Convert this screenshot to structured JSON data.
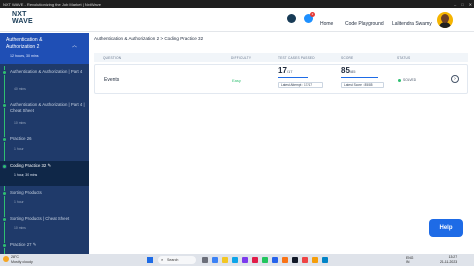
{
  "window": {
    "title": "NXT WAVE - Revolutionizing the Job Market | NxtWave",
    "controls": [
      "–",
      "□",
      "✕"
    ]
  },
  "header": {
    "logo_top": "NXT",
    "logo_bottom": "WAVE",
    "notification_count": "2",
    "home": "Home",
    "code_playground": "Code Playground",
    "user_name": "Lalitendra Swamy"
  },
  "sidebar": {
    "title": "Authentication & Authorization 2",
    "duration": "12 hours, 30 mins",
    "items": [
      {
        "label": "Authentication & Authorization | Part 4",
        "duration": "40 mins"
      },
      {
        "label": "Authentication & Authorization | Part 4 | Cheat Sheet",
        "duration": "10 mins"
      },
      {
        "label": "Practice 26",
        "duration": "1 hour"
      },
      {
        "label": "Coding Practice 32",
        "duration": "1 hour, 30 mins"
      },
      {
        "label": "Sorting Products",
        "duration": "1 hour"
      },
      {
        "label": "Sorting Products | Cheat Sheet",
        "duration": "10 mins"
      },
      {
        "label": "Practice 27",
        "duration": ""
      }
    ]
  },
  "main": {
    "breadcrumb": "Authentication & Authorization 2 > Coding Practice 32",
    "columns": [
      "QUESTION",
      "DIFFICULTY",
      "TEST CASES PASSED",
      "SCORE",
      "STATUS"
    ],
    "row": {
      "question": "Events",
      "difficulty": "Easy",
      "tests_passed": "17",
      "tests_total": "/17",
      "tests_fraction": 1.0,
      "latest_attempt": "Latest Attempt : 17/17",
      "score": "85",
      "score_total": "/85",
      "score_fraction": 1.0,
      "latest_score": "Latest Score : 85/85",
      "status": "SOLVED"
    }
  },
  "help": "Help",
  "taskbar": {
    "temperature": "28°C",
    "weather": "Mostly cloudy",
    "search": "Search",
    "lang": "ENG",
    "region": "IN",
    "time": "13:27",
    "date": "21-11-2023"
  }
}
